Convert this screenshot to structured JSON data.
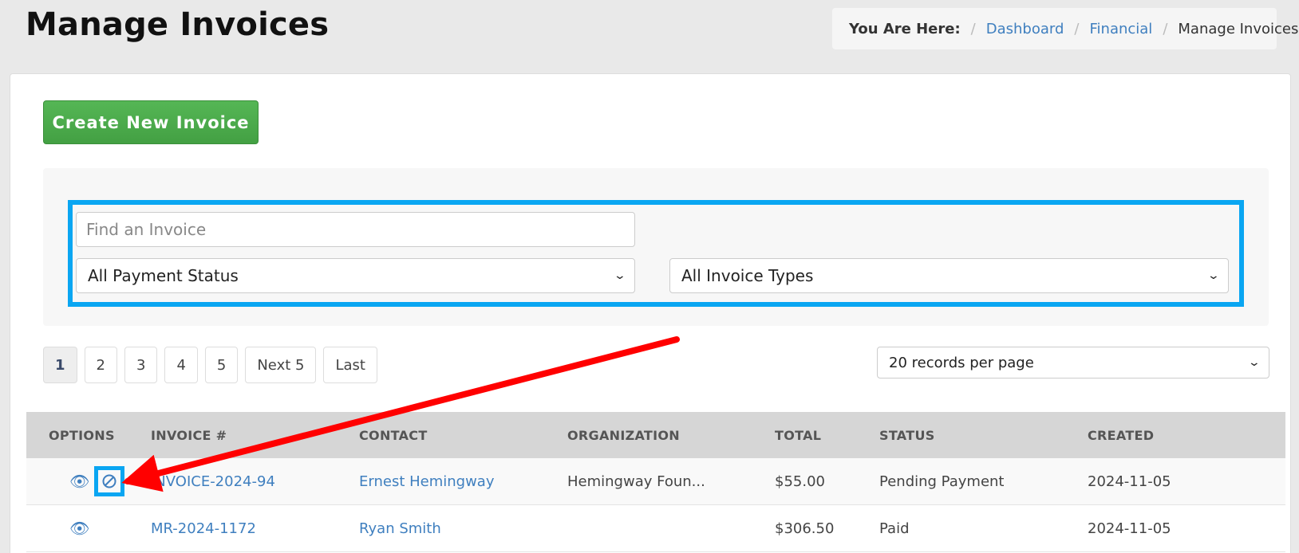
{
  "page": {
    "title": "Manage Invoices"
  },
  "breadcrumb": {
    "label": "You Are Here:",
    "items": [
      {
        "label": "Dashboard"
      },
      {
        "label": "Financial"
      },
      {
        "label": "Manage Invoices"
      }
    ]
  },
  "actions": {
    "create_label": "Create New Invoice"
  },
  "filters": {
    "search_placeholder": "Find an Invoice",
    "payment_status": "All Payment Status",
    "invoice_types": "All Invoice Types"
  },
  "pagination": {
    "pages": [
      "1",
      "2",
      "3",
      "4",
      "5"
    ],
    "next_label": "Next 5",
    "last_label": "Last",
    "active_page": "1",
    "per_page": "20 records per page"
  },
  "table": {
    "headers": [
      "OPTIONS",
      "INVOICE #",
      "CONTACT",
      "ORGANIZATION",
      "TOTAL",
      "STATUS",
      "CREATED"
    ],
    "rows": [
      {
        "invoice": "INVOICE-2024-94",
        "contact": "Ernest Hemingway",
        "organization": "Hemingway Foun...",
        "total": "$55.00",
        "status": "Pending Payment",
        "created": "2024-11-05",
        "has_cancel": true
      },
      {
        "invoice": "MR-2024-1172",
        "contact": "Ryan Smith",
        "organization": "",
        "total": "$306.50",
        "status": "Paid",
        "created": "2024-11-05",
        "has_cancel": false
      }
    ]
  },
  "annotations": {
    "highlight_color": "#0aa6f2",
    "arrow_color": "#ff0000"
  },
  "colors": {
    "brand_green": "#4cae4c",
    "link_blue": "#3f7fbf"
  }
}
